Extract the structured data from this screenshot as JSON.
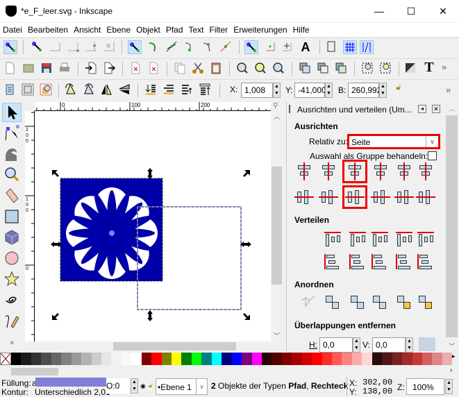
{
  "window": {
    "title": "*e_F_leer.svg - Inkscape",
    "minimize": "—",
    "maximize": "☐",
    "close": "✕"
  },
  "menu": [
    "Datei",
    "Bearbeiten",
    "Ansicht",
    "Ebene",
    "Objekt",
    "Pfad",
    "Text",
    "Filter",
    "Erweiterungen",
    "Hilfe"
  ],
  "toolbar3": {
    "x_label": "X:",
    "x_value": "1,008",
    "y_label": "Y:",
    "y_value": "-41,000",
    "b_label": "B:",
    "b_value": "260,992",
    "more": "»"
  },
  "toolbar2": {
    "more": "»"
  },
  "ruler": {
    "top": [
      "0",
      "100",
      "200"
    ],
    "left": [
      "2\n0\n0",
      "1\n0\n0",
      "0"
    ]
  },
  "dock": {
    "title": "Ausrichten und verteilen (Um...",
    "ausrichten": "Ausrichten",
    "relativ_label": "Relativ zu:",
    "relativ_value": "Seite",
    "group_label": "Auswahl als Gruppe behandeln:",
    "verteilen": "Verteilen",
    "anordnen": "Anordnen",
    "ueberlappungen": "Überlappungen entfernen",
    "h_label": "H:",
    "h_value": "0,0",
    "v_label": "V:",
    "v_value": "0,0"
  },
  "palette": [
    "#000000",
    "#1a1a1a",
    "#333333",
    "#4d4d4d",
    "#666666",
    "#808080",
    "#999999",
    "#b3b3b3",
    "#cccccc",
    "#e6e6e6",
    "#f2f2f2",
    "#f8f8f8",
    "#ffffff",
    "#800000",
    "#ff0000",
    "#808000",
    "#ffff00",
    "#008000",
    "#00ff00",
    "#008080",
    "#00ffff",
    "#000080",
    "#0000ff",
    "#800080",
    "#ff00ff",
    "#2b0000",
    "#550000",
    "#800000",
    "#aa0000",
    "#d40000",
    "#ff0000",
    "#ff2a2a",
    "#ff5555",
    "#ff8080",
    "#ffaaaa",
    "#ffd5d5",
    "#280b0b",
    "#501616",
    "#782121",
    "#a02c2c",
    "#c83737",
    "#d35f5f",
    "#de8787",
    "#e9afaf"
  ],
  "status": {
    "fill_label": "Füllung:",
    "fill_suffix": "a",
    "fill_color": "#8080d8",
    "stroke_label": "Kontur:",
    "stroke_value": "Unterschiedlich 2,01",
    "opacity": "O:0",
    "layer": "•Ebene 1",
    "message_count": "2",
    "message_text": " Objekte der Typen ",
    "message_type1": "Pfad",
    "message_sep": ", ",
    "message_type2": "Rechteck",
    "x_label": "X:",
    "x_value": "302,00",
    "y_label": "Y:",
    "y_value": "138,00",
    "z_label": "Z:",
    "zoom": "100%"
  },
  "colors": {
    "object_blue": "#0000a8",
    "highlight": "#e00000"
  }
}
